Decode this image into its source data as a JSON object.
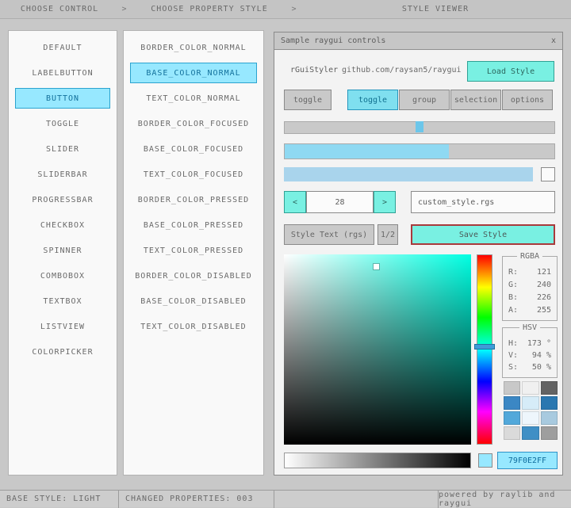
{
  "header": {
    "separator": ">",
    "choose_control": "CHOOSE CONTROL",
    "choose_property_style": "CHOOSE PROPERTY STYLE",
    "style_viewer": "STYLE VIEWER"
  },
  "controls_list": {
    "items": [
      "DEFAULT",
      "LABELBUTTON",
      "BUTTON",
      "TOGGLE",
      "SLIDER",
      "SLIDERBAR",
      "PROGRESSBAR",
      "CHECKBOX",
      "SPINNER",
      "COMBOBOX",
      "TEXTBOX",
      "LISTVIEW",
      "COLORPICKER"
    ],
    "selected": "BUTTON"
  },
  "properties_list": {
    "items": [
      "BORDER_COLOR_NORMAL",
      "BASE_COLOR_NORMAL",
      "TEXT_COLOR_NORMAL",
      "BORDER_COLOR_FOCUSED",
      "BASE_COLOR_FOCUSED",
      "TEXT_COLOR_FOCUSED",
      "BORDER_COLOR_PRESSED",
      "BASE_COLOR_PRESSED",
      "TEXT_COLOR_PRESSED",
      "BORDER_COLOR_DISABLED",
      "BASE_COLOR_DISABLED",
      "TEXT_COLOR_DISABLED"
    ],
    "selected": "BASE_COLOR_NORMAL"
  },
  "viewer": {
    "title": "Sample raygui controls",
    "close": "x",
    "brand": "rGuiStyler",
    "repo": "github.com/raysan5/raygui",
    "load_style": "Load Style",
    "toggle_button": "toggle",
    "toggle_group": [
      "toggle",
      "group",
      "selection",
      "options"
    ],
    "active_toggle": "toggle",
    "slider_pos_pct": 50,
    "progress_pct": 61,
    "spinner": {
      "decrement": "<",
      "value": "28",
      "increment": ">"
    },
    "filename": "custom_style.rgs",
    "style_text_button": "Style Text (rgs)",
    "pager": "1/2",
    "save_style": "Save Style",
    "rgba_panel": {
      "title": "RGBA",
      "rows": [
        {
          "label": "R:",
          "value": "121"
        },
        {
          "label": "G:",
          "value": "240"
        },
        {
          "label": "B:",
          "value": "226"
        },
        {
          "label": "A:",
          "value": "255"
        }
      ]
    },
    "hsv_panel": {
      "title": "HSV",
      "rows": [
        {
          "label": "H:",
          "value": "173 °"
        },
        {
          "label": "V:",
          "value": "94 %"
        },
        {
          "label": "S:",
          "value": "50 %"
        }
      ]
    },
    "hue_deg": 173,
    "picker_color": "#00ffe2",
    "palette": [
      "#c8c8c8",
      "#f0f0f0",
      "#636363",
      "#3b87c4",
      "#d6ecf8",
      "#2a77b0",
      "#52a8da",
      "#eef6fc",
      "#a8cadf",
      "#dadada",
      "#3f8fc5",
      "#9e9e9e"
    ],
    "hex_value": "79F0E2FF"
  },
  "status_bar": {
    "base_style": "BASE STYLE: LIGHT",
    "changed_properties": "CHANGED PROPERTIES: 003",
    "powered_by": "powered by raylib and raygui"
  },
  "colors": {
    "background": "#c8c8c8",
    "selection_blue": "#97e8ff",
    "edited_base_teal": "#79f0e2",
    "save_border_red": "#a83a3c"
  }
}
